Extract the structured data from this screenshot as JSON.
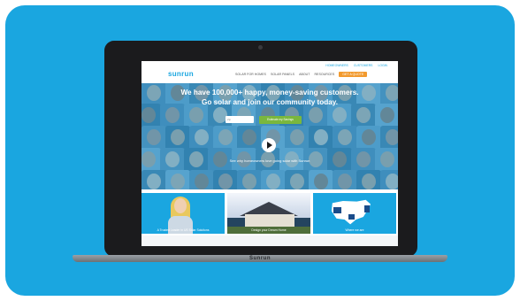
{
  "laptop": {
    "brand_label": "Sunrun"
  },
  "site": {
    "logo": "sunrun",
    "utility_links": [
      "HOMEOWNERS",
      "CUSTOMERS",
      "LOGIN"
    ],
    "nav": [
      {
        "label": "SOLAR FOR HOMES"
      },
      {
        "label": "SOLAR PANELS"
      },
      {
        "label": "ABOUT"
      },
      {
        "label": "RESOURCES"
      }
    ],
    "nav_cta": "GET A QUOTE"
  },
  "hero": {
    "headline_line1": "We have 100,000+ happy, money-saving customers.",
    "headline_line2": "Go solar and join our community today.",
    "zip_placeholder": "Zip",
    "submit_label": "Estimate my Savings",
    "caption": "See why homeowners love going solar with Sunrun"
  },
  "cards": [
    {
      "label": "A Trusted Leader in US Solar Solutions"
    },
    {
      "label": "Design your Dream Home"
    },
    {
      "label": "Where we are"
    }
  ],
  "colors": {
    "brand_blue": "#1aa6e0",
    "cta_orange": "#f29a2e",
    "submit_green": "#7ab73d",
    "laptop_body": "#1b1b1d"
  }
}
